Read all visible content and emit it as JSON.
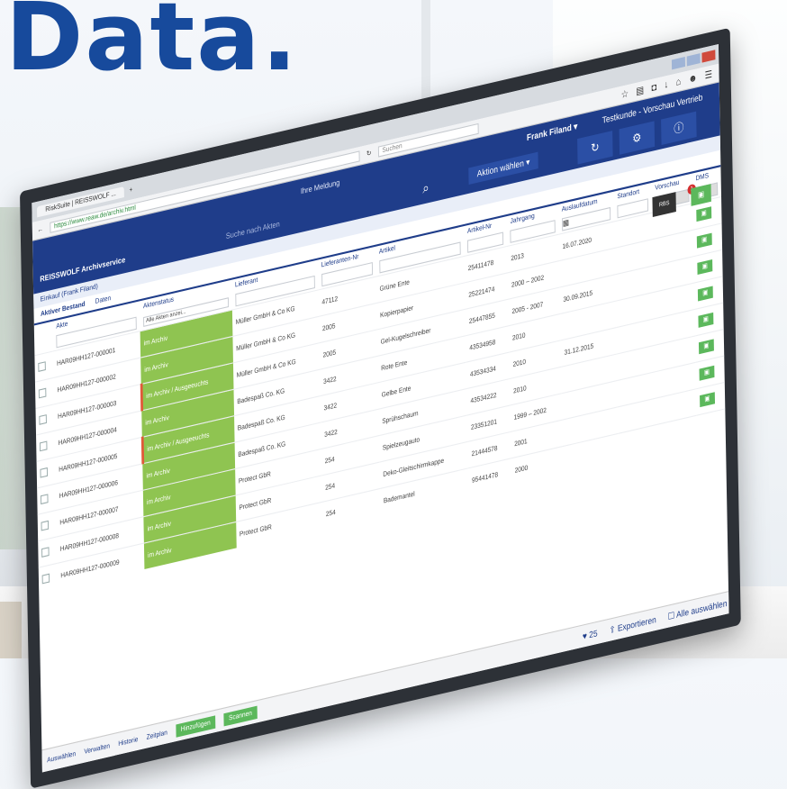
{
  "headline": "Data.",
  "browser": {
    "tab_label": "RiskSuite | REISSWOLF ...",
    "url": "https://www.reaw.de/archiv.html",
    "search_placeholder": "Suchen",
    "toolbar_icons": [
      "star-icon",
      "clipboard-icon",
      "pocket-icon",
      "download-icon",
      "home-icon",
      "chat-icon",
      "menu-icon"
    ]
  },
  "app": {
    "logo": "REISSWOLF Archivservice",
    "search_placeholder": "Suche nach Akten",
    "meldung": "Ihre Meldung",
    "aktion": "Aktion wählen ▾",
    "user": "Frank Filand ▾",
    "company": "Testkunde - Vorschau Vertrieb",
    "breadcrumb": "Einkauf (Frank Filand)",
    "badge": "1",
    "logo_box": "RBS"
  },
  "tabs": [
    "Aktiver Bestand",
    "Daten"
  ],
  "columns": [
    "Akte",
    "Aktenstatus",
    "Lieferant",
    "Lieferanten-Nr",
    "Artikel",
    "Artikel-Nr",
    "Jahrgang",
    "Auslaufdatum",
    "Standort",
    "Vorschau",
    "DMS"
  ],
  "filter_status": "Alle Akten anzei...",
  "rows": [
    [
      "HAR09HH127-000001",
      "im Archiv",
      "Müller GmbH & Co KG",
      "47112",
      "Grüne Ente",
      "25411478",
      "2013",
      "16.07.2020"
    ],
    [
      "HAR09HH127-000002",
      "im Archiv",
      "Müller GmbH & Co KG",
      "2005",
      "Kopierpapier",
      "25221474",
      "2000 – 2002",
      ""
    ],
    [
      "HAR09HH127-000003",
      "im Archiv / Ausgeeuchts",
      "Müller GmbH & Co KG",
      "2005",
      "Gel-Kugelschreiber",
      "25447855",
      "2005 - 2007",
      "30.09.2015"
    ],
    [
      "HAR09HH127-000004",
      "im Archiv",
      "Badespaß Co. KG",
      "3422",
      "Rote Ente",
      "43534958",
      "2010",
      ""
    ],
    [
      "HAR09HH127-000005",
      "im Archiv / Ausgeeuchts",
      "Badespaß Co. KG",
      "3422",
      "Gelbe Ente",
      "43534334",
      "2010",
      "31.12.2015"
    ],
    [
      "HAR09HH127-000006",
      "im Archiv",
      "Badespaß Co. KG",
      "3422",
      "Sprühschaum",
      "43534222",
      "2010",
      ""
    ],
    [
      "HAR09HH127-000007",
      "im Archiv",
      "Protect GbR",
      "254",
      "Spielzeugauto",
      "23351201",
      "1999 – 2002",
      ""
    ],
    [
      "HAR09HH127-000008",
      "im Archiv",
      "Protect GbR",
      "254",
      "Deko-Gleitschirmkappe",
      "21444578",
      "2001",
      ""
    ],
    [
      "HAR09HH127-000009",
      "im Archiv",
      "Protect GbR",
      "254",
      "Bademantel",
      "95441478",
      "2000",
      ""
    ]
  ],
  "footer": {
    "items": [
      "Auswählen",
      "Verwalten",
      "Historie",
      "Zeitplan"
    ],
    "green_buttons": [
      "Hinzufügen",
      "Scannen"
    ],
    "count": "♥ 25",
    "export": "Exportieren",
    "select_all": "Alle auswählen"
  }
}
